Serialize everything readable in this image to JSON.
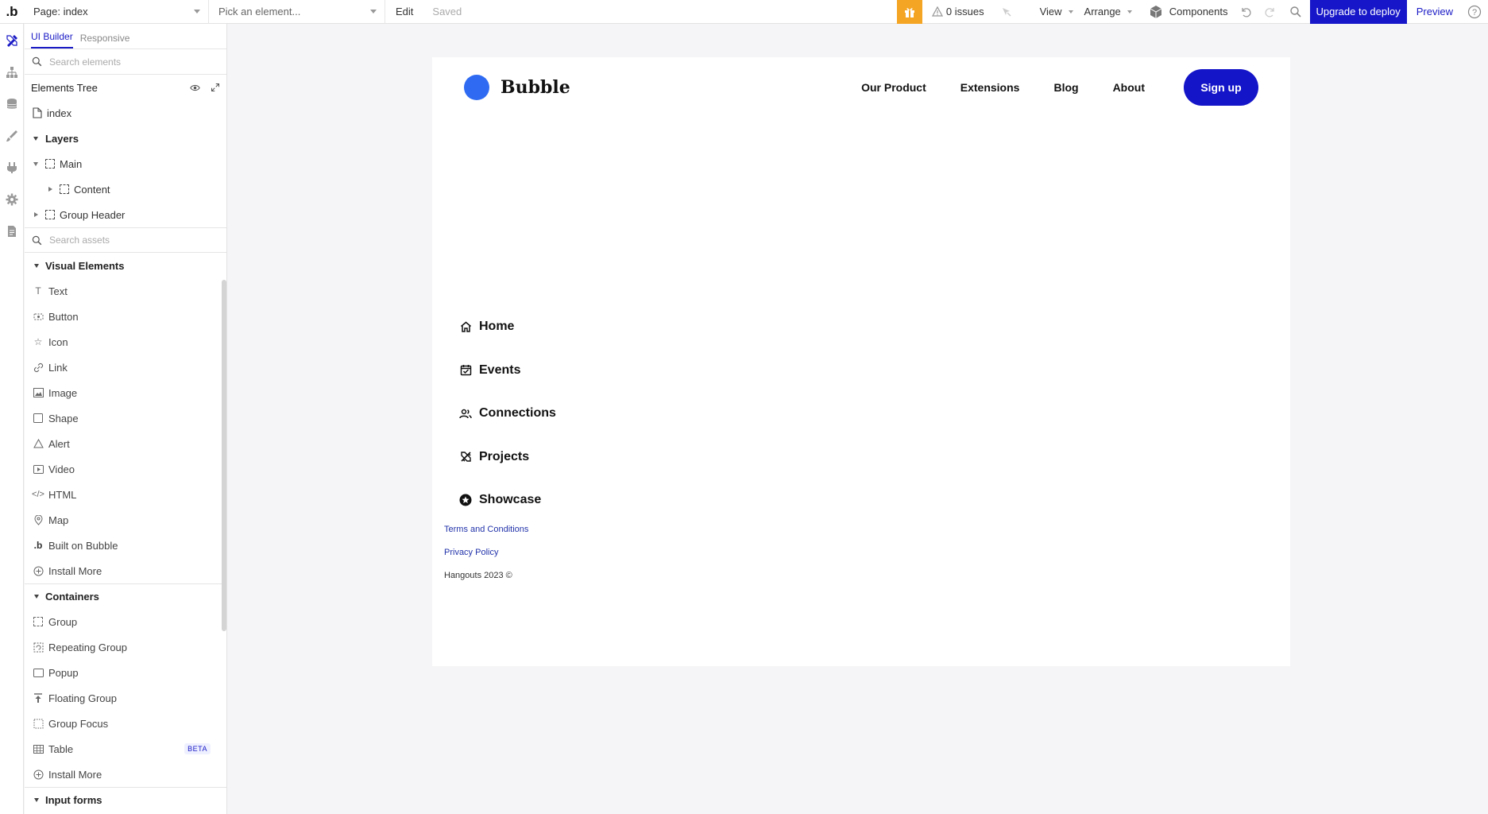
{
  "topbar": {
    "logo": ".b",
    "page_select": "Page: index",
    "element_select_placeholder": "Pick an element...",
    "edit": "Edit",
    "saved": "Saved",
    "issues": "0 issues",
    "view": "View",
    "arrange": "Arrange",
    "components": "Components",
    "upgrade": "Upgrade to deploy",
    "preview": "Preview"
  },
  "panel": {
    "tabs": [
      "UI Builder",
      "Responsive"
    ],
    "search_elements_placeholder": "Search elements",
    "tree_title": "Elements Tree",
    "tree": {
      "index": "index",
      "layers": "Layers",
      "main": "Main",
      "content": "Content",
      "group_header": "Group Header"
    },
    "search_assets_placeholder": "Search assets",
    "visual_title": "Visual Elements",
    "visual_items": [
      "Text",
      "Button",
      "Icon",
      "Link",
      "Image",
      "Shape",
      "Alert",
      "Video",
      "HTML",
      "Map",
      "Built on Bubble",
      "Install More"
    ],
    "containers_title": "Containers",
    "container_items": [
      "Group",
      "Repeating Group",
      "Popup",
      "Floating Group",
      "Group Focus",
      "Table",
      "Install More"
    ],
    "beta": "BETA",
    "inputs_title": "Input forms"
  },
  "canvas": {
    "brand": "Bubble",
    "nav": [
      "Our Product",
      "Extensions",
      "Blog",
      "About"
    ],
    "signup": "Sign up",
    "sidenav": [
      "Home",
      "Events",
      "Connections",
      "Projects",
      "Showcase"
    ],
    "terms": "Terms and Conditions",
    "privacy": "Privacy Policy",
    "copyright": "Hangouts 2023 ©"
  },
  "colors": {
    "accent": "#1414c9",
    "brand_dot": "#2f6bf2",
    "gift": "#f5a524"
  }
}
